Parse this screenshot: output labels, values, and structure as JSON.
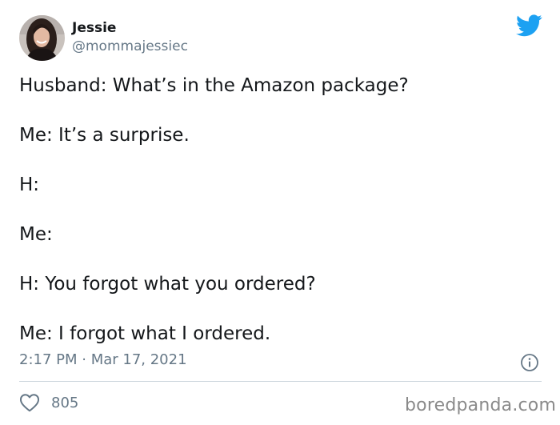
{
  "author": {
    "display_name": "Jessie",
    "handle": "@mommajessiec"
  },
  "tweet": {
    "lines": [
      "Husband: What’s in the Amazon package?",
      "Me: It’s a surprise.",
      "H:",
      "Me:",
      "H: You forgot what you ordered?",
      "Me: I forgot what I ordered."
    ],
    "timestamp": "2:17 PM · Mar 17, 2021",
    "like_count": "805"
  },
  "watermark": "boredpanda.com",
  "icons": {
    "brand": "twitter-bird-icon",
    "info": "info-icon",
    "like": "heart-icon"
  },
  "colors": {
    "twitter_blue": "#1da1f2",
    "text": "#14171a",
    "secondary": "#657786",
    "divider": "#ccd6dd"
  }
}
